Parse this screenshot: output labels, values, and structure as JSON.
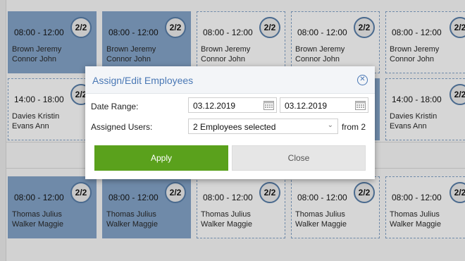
{
  "badge": "2/2",
  "rows": [
    {
      "tiles": [
        {
          "time": "08:00 - 12:00",
          "name1": "Brown Jeremy",
          "name2": "Connor John"
        },
        {
          "time": "08:00 - 12:00",
          "name1": "Brown Jeremy",
          "name2": "Connor John"
        },
        {
          "time": "08:00 - 12:00",
          "name1": "Brown Jeremy",
          "name2": "Connor John"
        },
        {
          "time": "08:00 - 12:00",
          "name1": "Brown Jeremy",
          "name2": "Connor John"
        },
        {
          "time": "08:00 - 12:00",
          "name1": "Brown Jeremy",
          "name2": "Connor John"
        }
      ]
    },
    {
      "tiles": [
        {
          "time": "14:00 - 18:00",
          "name1": "Davies Kristin",
          "name2": "Evans Ann"
        },
        {
          "time": "14:00 - 18:00",
          "name1": "Davies Kristin",
          "name2": "Evans Ann"
        }
      ]
    },
    {
      "tiles": [
        {
          "time": "08:00 - 12:00",
          "name1": "Thomas Julius",
          "name2": "Walker Maggie"
        },
        {
          "time": "08:00 - 12:00",
          "name1": "Thomas Julius",
          "name2": "Walker Maggie"
        },
        {
          "time": "08:00 - 12:00",
          "name1": "Thomas Julius",
          "name2": "Walker Maggie"
        },
        {
          "time": "08:00 - 12:00",
          "name1": "Thomas Julius",
          "name2": "Walker Maggie"
        },
        {
          "time": "08:00 - 12:00",
          "name1": "Thomas Julius",
          "name2": "Walker Maggie"
        }
      ]
    }
  ],
  "dialog": {
    "title": "Assign/Edit Employees",
    "date_range_label": "Date Range:",
    "date_from": "03.12.2019",
    "date_to": "03.12.2019",
    "assigned_users_label": "Assigned Users:",
    "assigned_users_value": "2 Employees selected",
    "from_text": "from 2",
    "apply_label": "Apply",
    "close_label": "Close"
  },
  "colors": {
    "assigned_tile": "#6f8aa9",
    "open_tile": "#d6d6d6",
    "apply_button": "#5aa11c",
    "title_accent": "#4a78b5"
  }
}
